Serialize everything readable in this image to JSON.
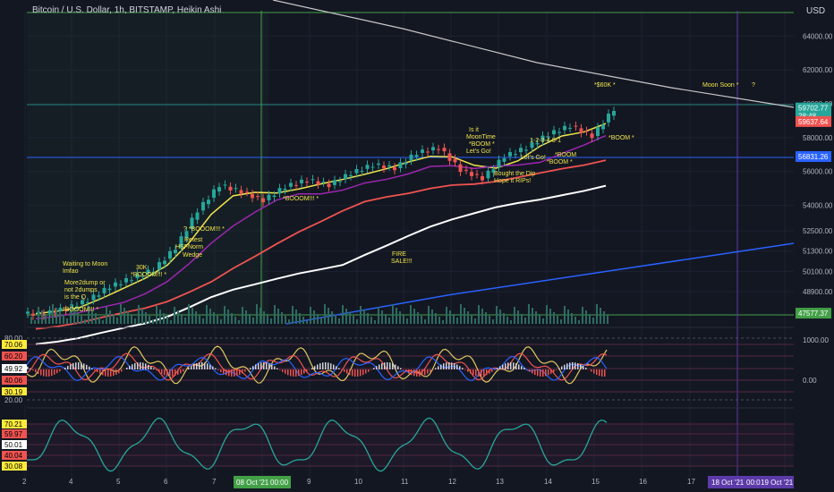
{
  "header": {
    "symbol_line": "Bitcoin / U.S. Dollar, 1h, BITSTAMP, Heikin Ashi"
  },
  "currency": {
    "label": "USD"
  },
  "colors": {
    "bg": "#131722",
    "up": "#26a69a",
    "down": "#ef5350",
    "grid": "#1e2230",
    "axis_text": "#b2b5be",
    "purple": "#9c27b0",
    "orange": "#ffa726",
    "yellow": "#f0e44c",
    "white": "#ffffff",
    "blue": "#2962ff",
    "green_box": "#43a047"
  },
  "chart_data": {
    "type": "candlestick",
    "price_axis": {
      "ticks": [
        "64000.00",
        "62000.00",
        "60000.00",
        "58000.00",
        "56000.00",
        "54000.00",
        "52500.00",
        "51300.00",
        "50100.00",
        "48900.00"
      ],
      "ylim": [
        47000,
        65500
      ]
    },
    "price_tags": [
      {
        "value": "59702.77",
        "sub": "28:48",
        "color": "#26a69a"
      },
      {
        "value": "59637.64",
        "color": "#ef5350"
      },
      {
        "value": "56831.26",
        "color": "#2962ff"
      },
      {
        "value": "47577.37",
        "color": "#43a047"
      }
    ],
    "x_axis": {
      "ticks": [
        "2",
        "4",
        "5",
        "6",
        "7",
        "8",
        "9",
        "10",
        "11",
        "12",
        "13",
        "14",
        "15",
        "16",
        "17",
        "18",
        "19"
      ],
      "highlight_labels": [
        "08 Oct '21",
        "00:00",
        "18 Oct '21",
        "00:0",
        "19 Oct '21"
      ]
    },
    "annotations": [
      "Waiting to Moon",
      "Imfao",
      "More2dump or",
      "not 2dumps",
      "is the Q",
      "*BOOOM!!! *",
      "30K",
      "*BOOOM!!! *",
      "Retest",
      "HSFNorm",
      "Wedge",
      "? *BOOOM!!! *",
      "*BOOOM!!! *",
      "FIRE",
      "SALE!!!",
      "Is it",
      "MoonTime",
      "*BOOM *",
      "Let's Go!",
      "1-2-3-4-5-1",
      "*BOOM",
      "*BOOM *",
      "Let's Go!",
      "Bought the Dip",
      "Hope it RIPs!",
      "*BOOM *",
      "*$60K *",
      "Moon Soon *",
      "?"
    ],
    "rsi_panel": {
      "ticks_left": [
        "80.00",
        "70.06",
        "60.20",
        "49.92",
        "40.06",
        "30.19",
        "20.00"
      ],
      "ticks_right": [
        "1000.00",
        "0.00"
      ]
    },
    "stoch_panel": {
      "ticks_left": [
        "70.21",
        "59.97",
        "50.01",
        "40.04",
        "30.08"
      ]
    },
    "series": [
      {
        "name": "",
        "values": [
          47600,
          47900,
          48400,
          49200,
          49700,
          50200,
          51500,
          53700,
          55200,
          54800,
          54300,
          55100,
          55500,
          55200,
          55900,
          56400,
          56200,
          57100,
          57400,
          56100,
          55600,
          56900,
          57400,
          58200,
          58700,
          58100,
          59700
        ]
      }
    ]
  }
}
